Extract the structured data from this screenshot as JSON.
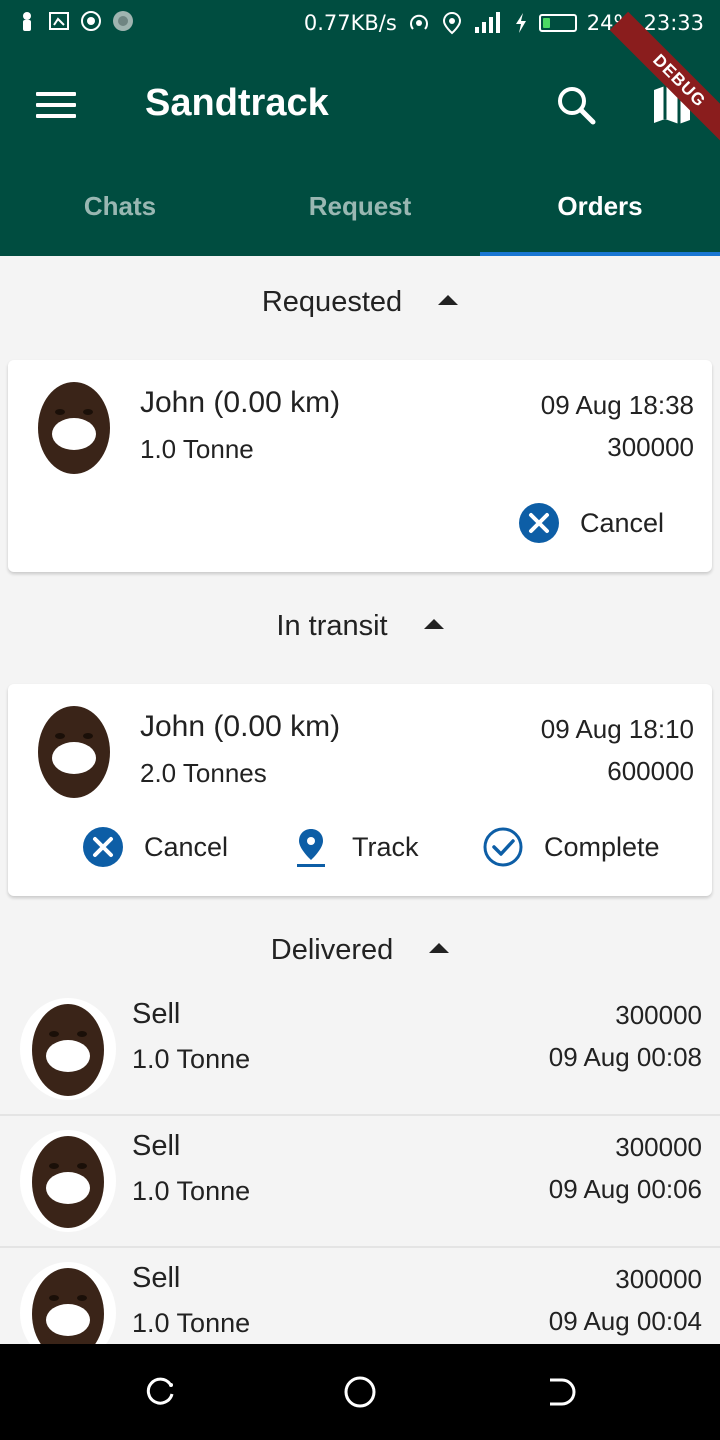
{
  "status_bar": {
    "net_speed": "0.77KB/s",
    "battery_percent": "24%",
    "battery_level": 0.24,
    "time": "23:33"
  },
  "app_bar": {
    "title": "Sandtrack",
    "debug_label": "DEBUG",
    "tabs": [
      {
        "label": "Chats",
        "active": false
      },
      {
        "label": "Request",
        "active": false
      },
      {
        "label": "Orders",
        "active": true
      }
    ]
  },
  "sections": {
    "requested": {
      "title": "Requested",
      "order": {
        "name": "John (0.00 km)",
        "quantity": "1.0 Tonne",
        "date": "09 Aug 18:38",
        "price": "300000"
      },
      "actions": {
        "cancel": "Cancel"
      }
    },
    "in_transit": {
      "title": "In transit",
      "order": {
        "name": "John (0.00 km)",
        "quantity": "2.0 Tonnes",
        "date": "09 Aug 18:10",
        "price": "600000"
      },
      "actions": {
        "cancel": "Cancel",
        "track": "Track",
        "complete": "Complete"
      }
    },
    "delivered": {
      "title": "Delivered",
      "items": [
        {
          "name": "Sell",
          "quantity": "1.0 Tonne",
          "price": "300000",
          "date": "09 Aug 00:08"
        },
        {
          "name": "Sell",
          "quantity": "1.0 Tonne",
          "price": "300000",
          "date": "09 Aug 00:06"
        },
        {
          "name": "Sell",
          "quantity": "1.0 Tonne",
          "price": "300000",
          "date": "09 Aug 00:04"
        }
      ]
    }
  },
  "colors": {
    "primary": "#004d40",
    "accent": "#1976d2",
    "action_blue": "#0d5ea6"
  }
}
